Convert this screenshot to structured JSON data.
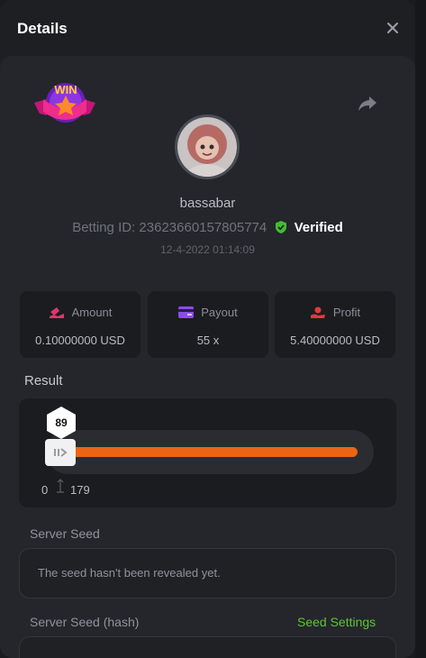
{
  "modal": {
    "title": "Details"
  },
  "user": {
    "username": "bassabar",
    "betting_id_label": "Betting ID:",
    "betting_id": "23623660157805774",
    "verified_label": "Verified",
    "datetime": "12-4-2022 01:14:09"
  },
  "badge": {
    "text": "WIN"
  },
  "stats": [
    {
      "label": "Amount",
      "value": "0.10000000 USD",
      "icon": "amount-icon",
      "color": "#e0356b"
    },
    {
      "label": "Payout",
      "value": "55 x",
      "icon": "payout-card-icon",
      "color": "#8b4cf0"
    },
    {
      "label": "Profit",
      "value": "5.40000000 USD",
      "icon": "profit-hand-icon",
      "color": "#e03b3b"
    }
  ],
  "result": {
    "label": "Result",
    "value": "89",
    "min": "0",
    "max": "179",
    "accent": "#ea6414"
  },
  "server_seed": {
    "label": "Server Seed",
    "text": "The seed hasn't been revealed yet."
  },
  "server_seed_hash": {
    "label": "Server Seed (hash)",
    "settings_link": "Seed Settings"
  }
}
